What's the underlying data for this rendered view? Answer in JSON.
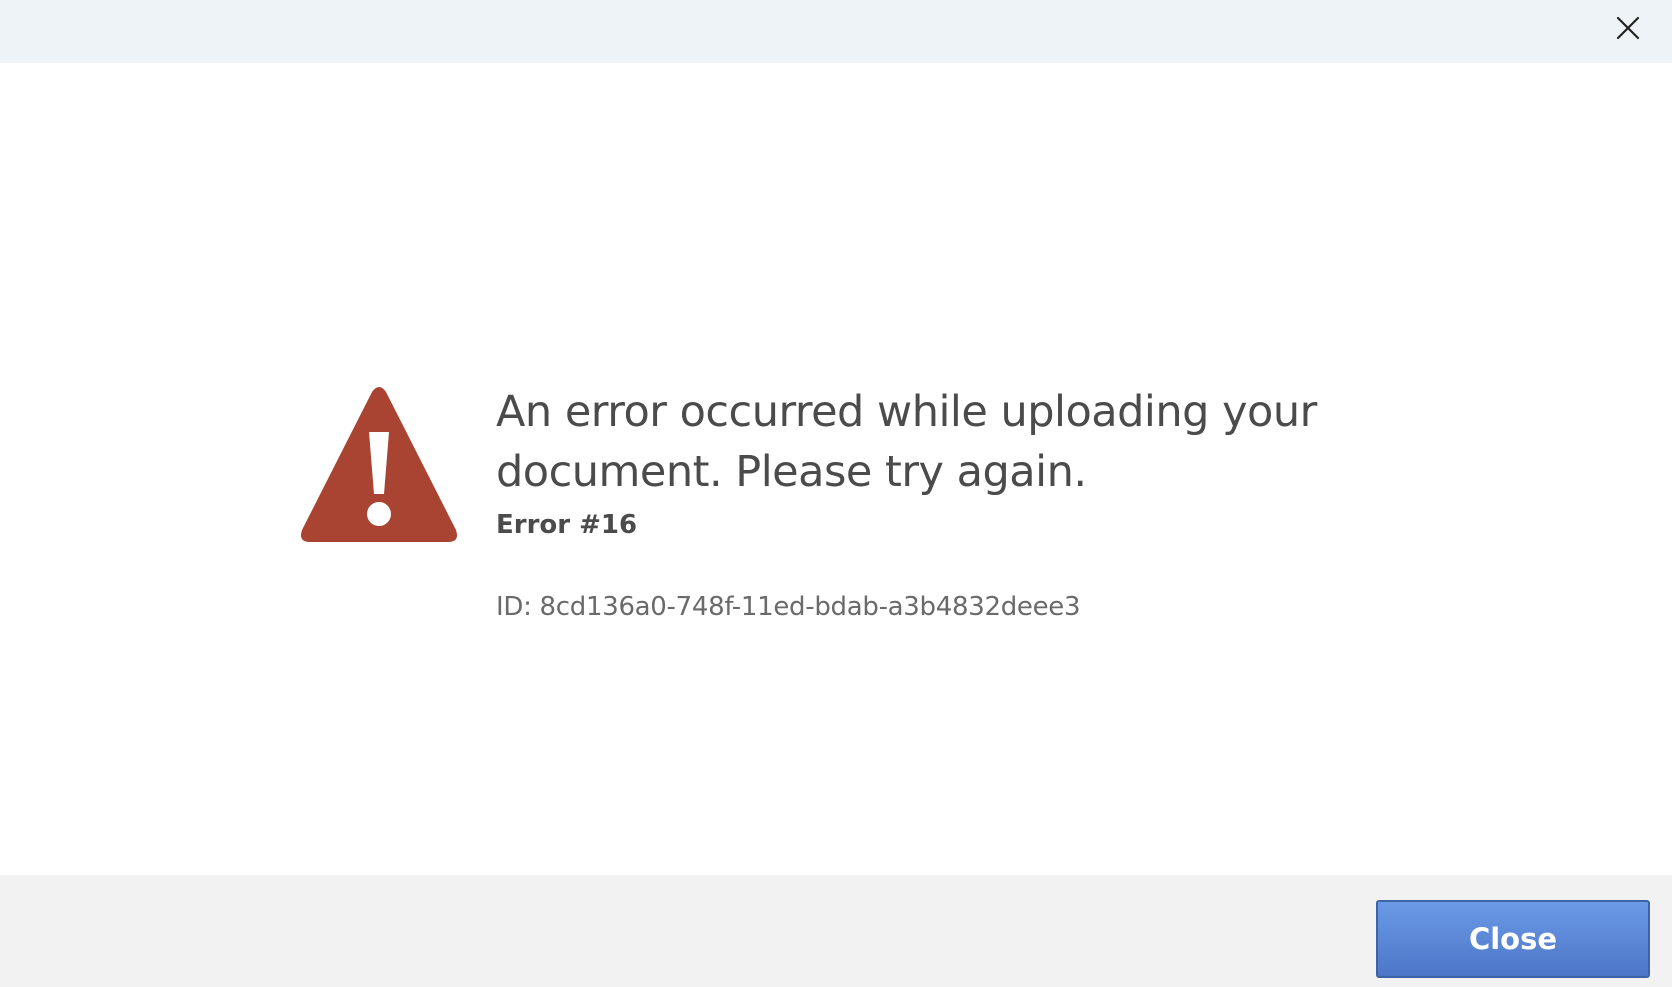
{
  "dialog": {
    "message": "An error occurred while uploading your document. Please try again.",
    "error_code": "Error #16",
    "error_id": "ID: 8cd136a0-748f-11ed-bdab-a3b4832deee3",
    "close_button_label": "Close"
  },
  "icons": {
    "titlebar_close": "close-icon",
    "warning": "warning-icon"
  },
  "colors": {
    "warning_icon": "#a84431",
    "primary_button": "#5a86d6",
    "titlebar_bg": "#eef3f8",
    "footer_bg": "#f2f2f2",
    "text": "#4b4b4b"
  }
}
